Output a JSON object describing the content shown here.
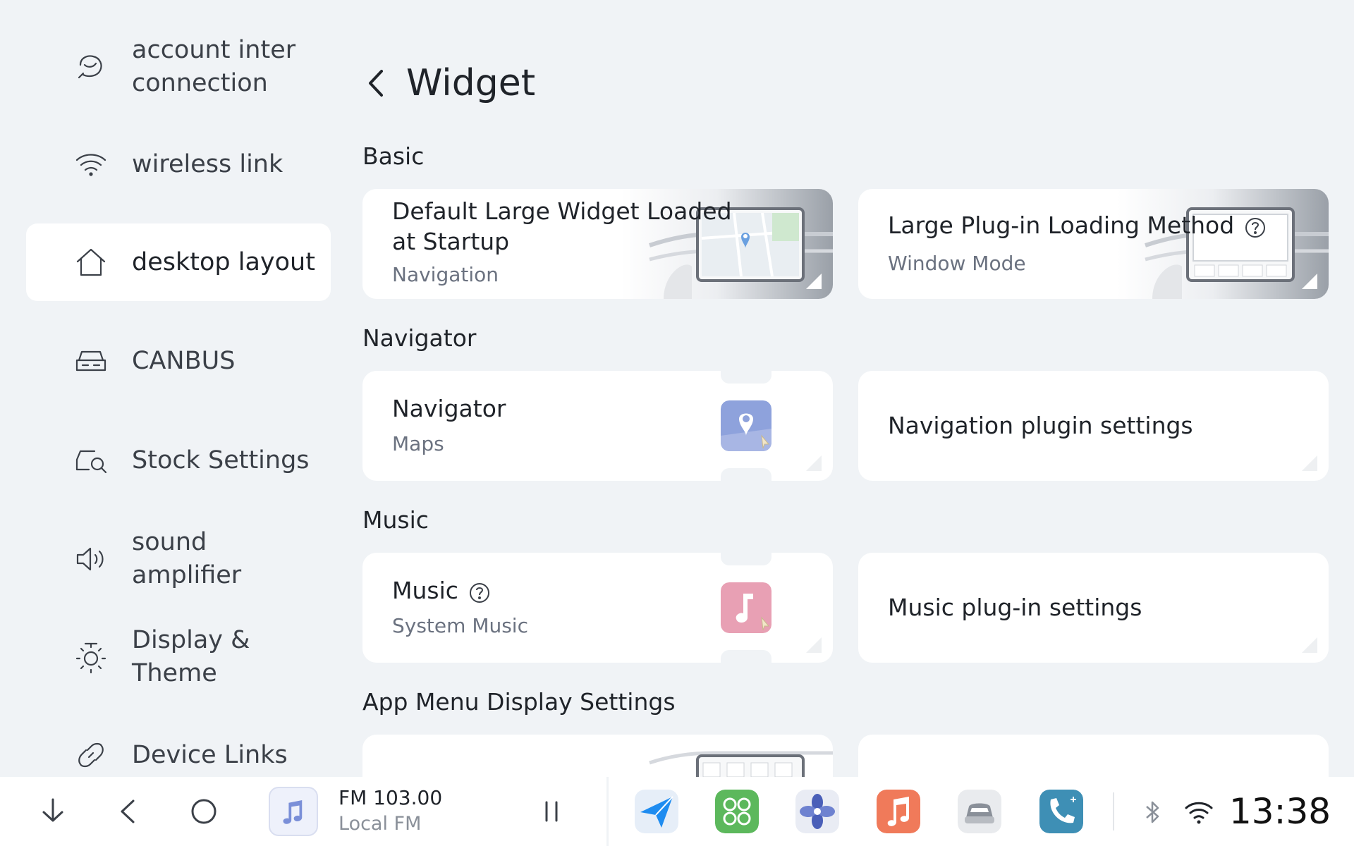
{
  "sidebar": {
    "items": [
      {
        "label": "account inter connection",
        "icon": "account-link-icon"
      },
      {
        "label": "wireless link",
        "icon": "wifi-icon"
      },
      {
        "label": "desktop layout",
        "icon": "home-icon",
        "active": true
      },
      {
        "label": "CANBUS",
        "icon": "car-icon"
      },
      {
        "label": "Stock Settings",
        "icon": "car-settings-icon"
      },
      {
        "label": "sound amplifier",
        "icon": "speaker-icon"
      },
      {
        "label": "Display & Theme",
        "icon": "brightness-icon"
      },
      {
        "label": "Device Links",
        "icon": "link-icon"
      }
    ]
  },
  "header": {
    "title": "Widget",
    "back_icon": "chevron-left-icon"
  },
  "sections": {
    "basic": "Basic",
    "navigator": "Navigator",
    "music": "Music",
    "app_menu": "App Menu Display Settings"
  },
  "cards": {
    "default_widget": {
      "title": "Default Large Widget Loaded at Startup",
      "value": "Navigation"
    },
    "plugin_loading": {
      "title": "Large Plug-in Loading Method",
      "value": "Window Mode"
    },
    "navigator": {
      "title": "Navigator",
      "value": "Maps"
    },
    "nav_plugin": {
      "title": "Navigation plugin settings"
    },
    "music": {
      "title": "Music",
      "value": "System Music"
    },
    "music_plugin": {
      "title": "Music plug-in settings"
    }
  },
  "bottombar": {
    "radio_title": "FM 103.00",
    "radio_subtitle": "Local FM",
    "clock": "13:38",
    "dock_apps": [
      "navigation-app-icon",
      "apps-grid-icon",
      "fan-icon",
      "music-app-icon",
      "car-app-icon",
      "phone-app-icon"
    ]
  },
  "colors": {
    "background": "#f0f3f6",
    "card": "#ffffff",
    "nav_tile": "#8ea2dc",
    "music_tile": "#e8a0b4",
    "dock_nav": "#1e8cf0",
    "dock_grid": "#5cb85c",
    "dock_fan": "#7a8ed8",
    "dock_music": "#f07a5a",
    "dock_phone": "#3e8fb5"
  }
}
